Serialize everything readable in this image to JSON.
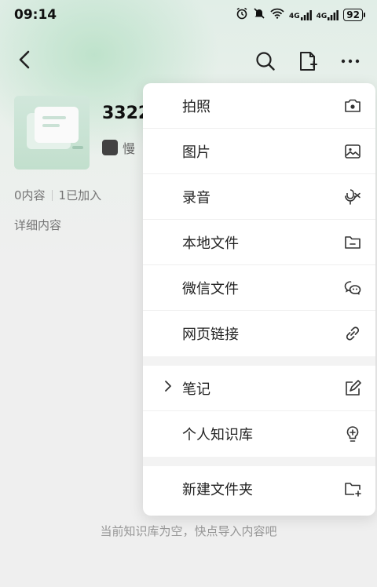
{
  "status_bar": {
    "time": "09:14",
    "signal_1": "4G",
    "signal_2": "4G",
    "battery": "92"
  },
  "nav": {
    "back": "back",
    "search": "search",
    "new_note": "new-note",
    "more": "more"
  },
  "knowledge_base": {
    "title": "3322",
    "owner": "慢",
    "content_count": "0内容",
    "joined_count": "1已加入",
    "detail_link": "详细内容",
    "empty_tip": "当前知识库为空，快点导入内容吧"
  },
  "menu": {
    "items": [
      {
        "label": "拍照",
        "icon": "camera-icon"
      },
      {
        "label": "图片",
        "icon": "image-icon"
      },
      {
        "label": "录音",
        "icon": "microphone-icon"
      },
      {
        "label": "本地文件",
        "icon": "folder-icon"
      },
      {
        "label": "微信文件",
        "icon": "wechat-icon"
      },
      {
        "label": "网页链接",
        "icon": "link-icon"
      },
      {
        "label": "笔记",
        "icon": "edit-icon"
      },
      {
        "label": "个人知识库",
        "icon": "bulb-icon"
      },
      {
        "label": "新建文件夹",
        "icon": "new-folder-icon"
      }
    ]
  }
}
